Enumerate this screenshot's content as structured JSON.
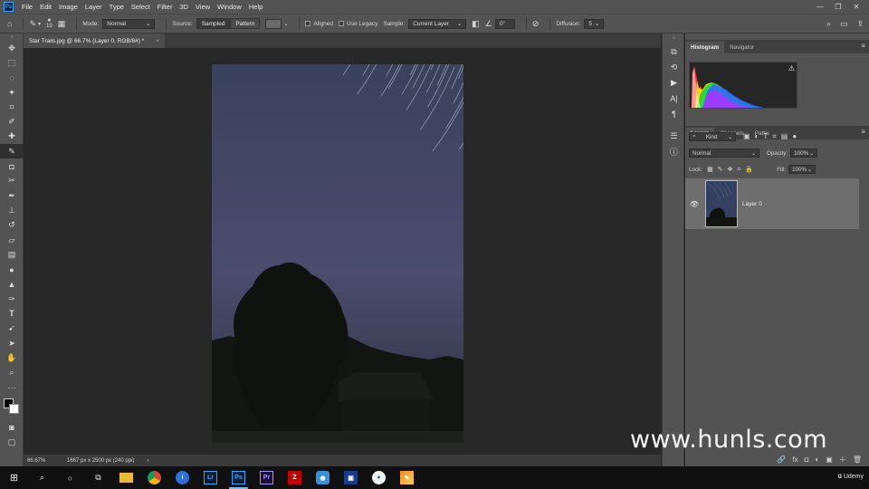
{
  "app": {
    "logo_text": "Ps"
  },
  "menu": [
    "File",
    "Edit",
    "Image",
    "Layer",
    "Type",
    "Select",
    "Filter",
    "3D",
    "View",
    "Window",
    "Help"
  ],
  "window_controls": [
    "—",
    "❐",
    "✕"
  ],
  "options": {
    "brush_size": "19",
    "mode_label": "Mode:",
    "mode_value": "Normal",
    "source_label": "Source:",
    "source_sampled": "Sampled",
    "source_pattern": "Pattern",
    "aligned_label": "Aligned",
    "use_legacy_label": "Use Legacy",
    "sample_label": "Sample:",
    "sample_value": "Current Layer",
    "angle_value": "0°",
    "diffusion_label": "Diffusion:",
    "diffusion_value": "5"
  },
  "document_tab": {
    "title": "Star Trails.jpg @ 66.7% (Layer 0, RGB/8#) *",
    "close": "×"
  },
  "status": {
    "zoom": "66.67%",
    "doc_info": "1667 px x 2500 px (240 ppi)",
    "arrow": "›"
  },
  "panels": {
    "top_tabs": [
      "Histogram",
      "Navigator"
    ],
    "warning_icon": "⚠",
    "layer_tabs": [
      "Layers",
      "Channels",
      "Paths"
    ],
    "filter_kind": "Kind",
    "blend_mode": "Normal",
    "opacity_label": "Opacity:",
    "opacity_value": "100%",
    "lock_label": "Lock:",
    "fill_label": "Fill:",
    "fill_value": "100%",
    "layer_name": "Layer 0",
    "footer_icons": [
      "🔗",
      "fx",
      "◘",
      "◐",
      "▣",
      "＋",
      "🗑"
    ]
  },
  "watermark": "www.hunls.com",
  "taskbar": {
    "apps": [
      "Lr",
      "Ps",
      "Pr"
    ],
    "udemy": "Udemy"
  },
  "colors": {
    "accent": "#31a8ff",
    "lightroom": "#31a8ff",
    "premiere": "#9999ff",
    "filezilla": "#bf0000"
  }
}
